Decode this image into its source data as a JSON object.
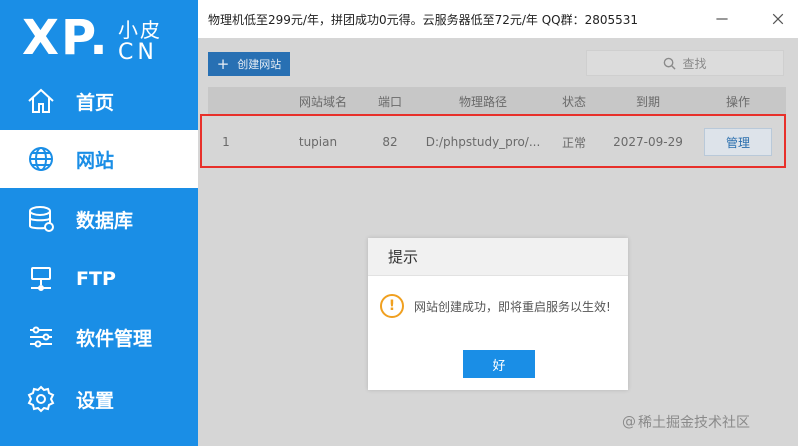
{
  "brand": {
    "logo_main": "XP.",
    "logo_sub_top": "小皮",
    "logo_sub_bottom": "CN"
  },
  "sidebar": {
    "items": [
      {
        "label": "首页",
        "icon": "home-icon",
        "active": false
      },
      {
        "label": "网站",
        "icon": "globe-icon",
        "active": true
      },
      {
        "label": "数据库",
        "icon": "database-icon",
        "active": false
      },
      {
        "label": "FTP",
        "icon": "ftp-icon",
        "active": false
      },
      {
        "label": "软件管理",
        "icon": "sliders-icon",
        "active": false
      },
      {
        "label": "设置",
        "icon": "gear-icon",
        "active": false
      }
    ]
  },
  "topbar": {
    "ad_text": "物理机低至299元/年，拼团成功0元得。云服务器低至72元/年  QQ群：2805531",
    "minimize_icon": "minimize-icon",
    "close_icon": "close-icon"
  },
  "toolbar": {
    "create_label": "创建网站",
    "search_label": "查找"
  },
  "table": {
    "headers": [
      "网站域名",
      "端口",
      "物理路径",
      "状态",
      "到期",
      "操作"
    ],
    "rows": [
      {
        "index": "1",
        "domain": "tupian",
        "port": "82",
        "path": "D:/phpstudy_pro/...",
        "status": "正常",
        "expire": "2027-09-29",
        "action": "管理"
      }
    ]
  },
  "dialog": {
    "title": "提示",
    "message": "网站创建成功，即将重启服务以生效!",
    "ok_label": "好",
    "icon": "warning-icon"
  },
  "watermark": {
    "text": "稀土掘金技术社区",
    "prefix": "@"
  },
  "colors": {
    "brand": "#1a8ee6",
    "highlight": "#e8302a",
    "warning": "#f0a020"
  }
}
